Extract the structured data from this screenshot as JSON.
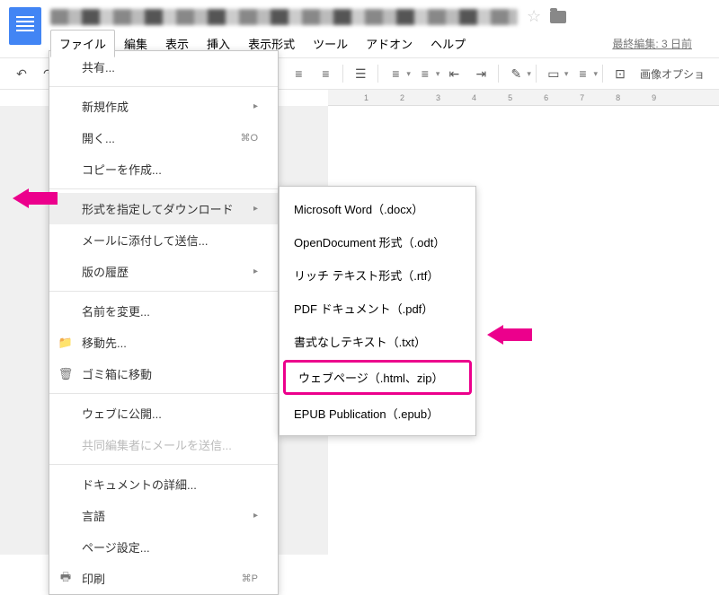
{
  "header": {
    "last_edit": "最終編集: 3 日前"
  },
  "menus": {
    "file": "ファイル",
    "edit": "編集",
    "view": "表示",
    "insert": "挿入",
    "format": "表示形式",
    "tools": "ツール",
    "addons": "アドオン",
    "help": "ヘルプ"
  },
  "toolbar": {
    "image_options": "画像オプショ"
  },
  "ruler": {
    "ticks": [
      "1",
      "2",
      "3",
      "4",
      "5",
      "6",
      "7",
      "8",
      "9"
    ]
  },
  "file_menu": {
    "share": "共有...",
    "new": "新規作成",
    "open": "開く...",
    "open_shortcut": "⌘O",
    "make_copy": "コピーを作成...",
    "download_as": "形式を指定してダウンロード",
    "email_attach": "メールに添付して送信...",
    "version_history": "版の履歴",
    "rename": "名前を変更...",
    "move_to": "移動先...",
    "move_to_trash": "ゴミ箱に移動",
    "publish_web": "ウェブに公開...",
    "email_collab": "共同編集者にメールを送信...",
    "doc_details": "ドキュメントの詳細...",
    "language": "言語",
    "page_setup": "ページ設定...",
    "print": "印刷",
    "print_shortcut": "⌘P"
  },
  "download_submenu": {
    "docx": "Microsoft Word（.docx）",
    "odt": "OpenDocument 形式（.odt）",
    "rtf": "リッチ テキスト形式（.rtf）",
    "pdf": "PDF ドキュメント（.pdf）",
    "txt": "書式なしテキスト（.txt）",
    "html": "ウェブページ（.html、zip）",
    "epub": "EPUB Publication（.epub）"
  }
}
